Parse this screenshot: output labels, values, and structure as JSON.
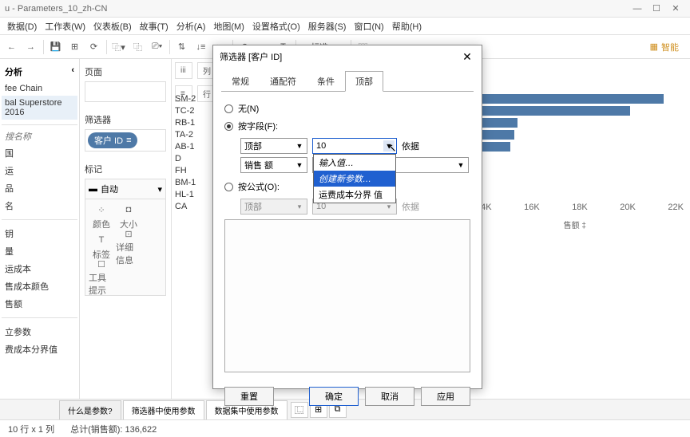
{
  "window": {
    "title": "u - Parameters_10_zh-CN",
    "min": "—",
    "max": "☐",
    "close": "✕"
  },
  "menu": {
    "data": "数据(D)",
    "worksheet": "工作表(W)",
    "dashboard": "仪表板(B)",
    "story": "故事(T)",
    "analysis": "分析(A)",
    "map": "地图(M)",
    "format": "设置格式(O)",
    "server": "服务器(S)",
    "window": "窗口(N)",
    "help": "帮助(H)"
  },
  "smart": "智能",
  "left": {
    "analysis": "分析",
    "src1": "fee Chain",
    "src2": "bal Superstore 2016",
    "search_ph": "搜名称",
    "dims": [
      {
        "t": "",
        "c": "blue"
      },
      {
        "t": "国",
        "c": "blue"
      },
      {
        "t": "运",
        "c": "blue"
      },
      {
        "t": "品",
        "c": "blue"
      },
      {
        "t": "名",
        "c": "blue"
      }
    ],
    "meas": [
      {
        "t": "钥",
        "c": "green"
      },
      {
        "t": "量",
        "c": "green"
      },
      {
        "t": "运成本",
        "c": "green"
      },
      {
        "t": "售成本颜色",
        "c": "green"
      },
      {
        "t": "售额",
        "c": "green"
      }
    ],
    "params_hdr": "",
    "params": [
      {
        "t": "立参数",
        "c": "green"
      },
      {
        "t": "费成本分界值",
        "c": "green"
      }
    ]
  },
  "pages": {
    "hdr": "页面",
    "filters_hdr": "筛选器",
    "pill": "客户 ID",
    "marks_hdr": "标记",
    "auto": "自动",
    "cells": {
      "color": "颜色",
      "size": "大小",
      "label": "标签",
      "detail": "详细信息",
      "tooltip": "工具提示"
    }
  },
  "viz": {
    "cols": "列",
    "rows": "行",
    "rowlabels": [
      "SM-2",
      "TC-2",
      "RB-1",
      "TA-2",
      "AB-1",
      "D",
      "FH",
      "BM-1",
      "HL-1",
      "CA"
    ],
    "axis": [
      "14K",
      "16K",
      "18K",
      "20K",
      "22K"
    ],
    "axislabel": "售额 ‡"
  },
  "chart_data": {
    "type": "bar",
    "categories": [
      "SM-2",
      "TC-2",
      "RB-1",
      "TA-2",
      "AB-1",
      "D",
      "FH",
      "BM-1",
      "HL-1",
      "CA"
    ],
    "values": [
      23.5,
      19.3,
      15.2,
      14.8,
      14.3,
      14.0,
      13.8,
      13.6,
      13.5,
      13.3
    ],
    "xlabel": "售额",
    "ylabel": "客户 ID",
    "unit": "K"
  },
  "dialog": {
    "title": "筛选器 [客户 ID]",
    "tabs": {
      "general": "常规",
      "wildcard": "通配符",
      "condition": "条件",
      "top": "顶部"
    },
    "none": "无(N)",
    "byfield": "按字段(F):",
    "byformula": "按公式(O):",
    "top": "顶部",
    "value": "10",
    "by": "依据",
    "measure": "销售 额",
    "dd": {
      "enter": "输入值…",
      "create": "创建新参数…",
      "sep": "运费成本分界 值"
    },
    "btns": {
      "reset": "重置",
      "ok": "确定",
      "cancel": "取消",
      "apply": "应用"
    }
  },
  "tabs": {
    "what": "什么是参数?",
    "filter": "筛选器中使用参数",
    "dataset": "数据集中使用参数"
  },
  "status": {
    "rows": "10 行 x 1 列",
    "sum": "总计(销售额): 136,622"
  }
}
